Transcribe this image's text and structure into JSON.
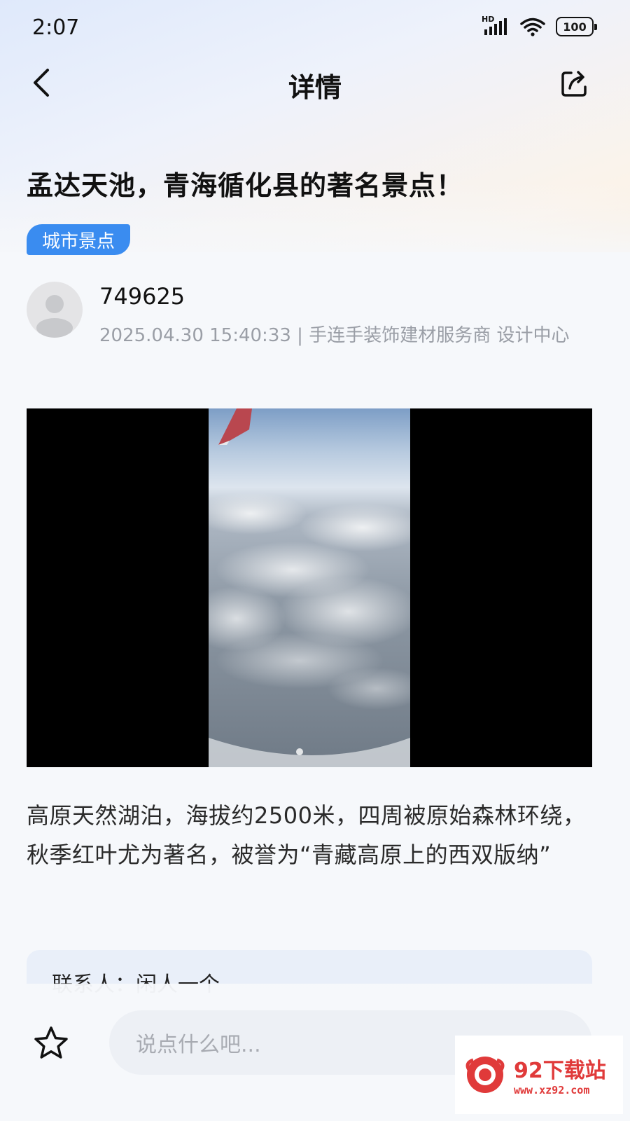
{
  "status_bar": {
    "time": "2:07",
    "signal_label": "HD",
    "battery": "100",
    "icons": [
      "signal-icon",
      "wifi-icon",
      "battery-icon"
    ]
  },
  "nav": {
    "title": "详情",
    "back_icon": "chevron-left-icon",
    "share_icon": "share-icon"
  },
  "article": {
    "title": "孟达天池，青海循化县的著名景点！",
    "tag": "城市景点",
    "author": {
      "name": "749625",
      "meta": "2025.04.30 15:40:33 | 手连手装饰建材服务商 设计中心"
    },
    "description": "高原天然湖泊，海拔约2500米，四周被原始森林环绕，秋季红叶尤为著名，被誉为“青藏高原上的西双版纳”",
    "contact": "联系人：闲人一个"
  },
  "bottom_bar": {
    "comment_placeholder": "说点什么吧...",
    "favorite_icon": "star-outline-icon"
  },
  "watermark": {
    "name": "92下载站",
    "url": "www.xz92.com"
  },
  "colors": {
    "accent": "#3a8cf0",
    "meta_text": "#9a9ea6",
    "watermark": "#e03a3a"
  }
}
